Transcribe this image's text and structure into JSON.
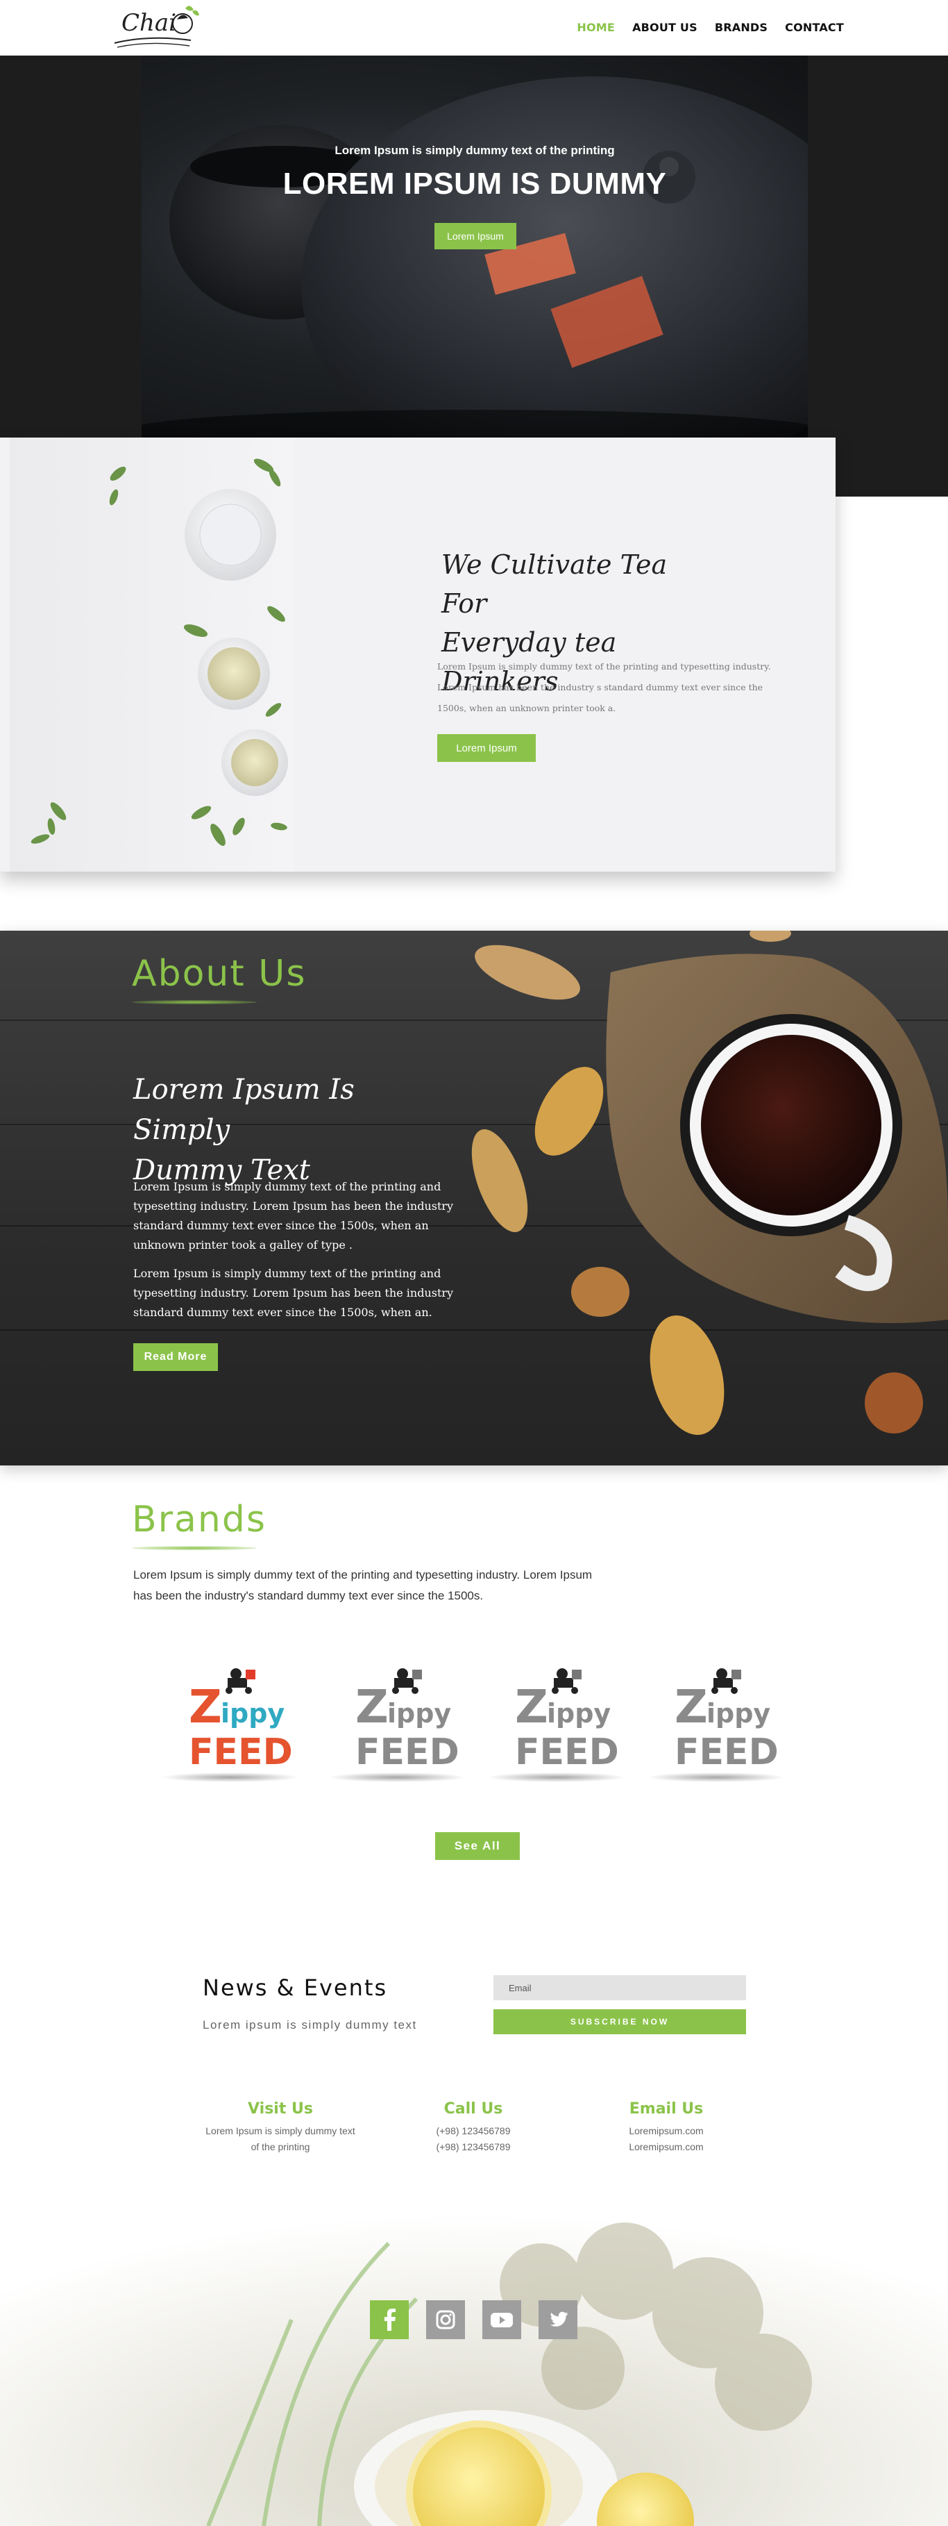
{
  "header": {
    "logo_text": "Chai",
    "nav": [
      {
        "label": "HOME",
        "active": true
      },
      {
        "label": "ABOUT US",
        "active": false
      },
      {
        "label": "BRANDS",
        "active": false
      },
      {
        "label": "CONTACT",
        "active": false
      }
    ]
  },
  "hero": {
    "overline": "Lorem Ipsum is simply dummy text of the printing",
    "title": "LOREM IPSUM IS DUMMY",
    "button_label": "Lorem Ipsum"
  },
  "cultivate": {
    "title_line1": "We Cultivate Tea For",
    "title_line2": "Everyday tea Drinkers",
    "text": "Lorem Ipsum is simply dummy text of the printing and typesetting industry. Lorem Ipsum has been the industry    s standard dummy text ever since the 1500s, when an unknown printer took a.",
    "button_label": "Lorem Ipsum"
  },
  "about": {
    "title": "About Us",
    "heading_line1": "Lorem Ipsum Is Simply",
    "heading_line2": "Dummy Text",
    "paragraph1": "Lorem Ipsum is simply dummy text of the printing and typesetting industry. Lorem Ipsum has been the industry standard dummy text ever since the 1500s, when an unknown printer took a galley of type .",
    "paragraph2": "Lorem Ipsum is simply dummy text of the printing and typesetting industry. Lorem Ipsum has been the industry standard dummy text ever since the 1500s, when an.",
    "button_label": "Read More"
  },
  "brands": {
    "title": "Brands",
    "description": "Lorem Ipsum is simply dummy text of the printing and typesetting industry. Lorem Ipsum has been the industry's standard dummy text ever since the 1500s.",
    "items": [
      {
        "line1_initial": "Z",
        "line1_rest": "ippy",
        "line2": "FEED",
        "colored": true
      },
      {
        "line1_initial": "Z",
        "line1_rest": "ippy",
        "line2": "FEED",
        "colored": false
      },
      {
        "line1_initial": "Z",
        "line1_rest": "ippy",
        "line2": "FEED",
        "colored": false
      },
      {
        "line1_initial": "Z",
        "line1_rest": "ippy",
        "line2": "FEED",
        "colored": false
      }
    ],
    "see_all_label": "See All"
  },
  "news": {
    "title": "News & Events",
    "subtitle": "Lorem ipsum is simply dummy text",
    "email_placeholder": "Email",
    "subscribe_label": "SUBSCRIBE NOW"
  },
  "contact": {
    "visit": {
      "title": "Visit Us",
      "line1": "Lorem Ipsum is simply dummy text",
      "line2": "of the printing"
    },
    "call": {
      "title": "Call Us",
      "line1": "(+98) 123456789",
      "line2": "(+98) 123456789"
    },
    "email": {
      "title": "Email Us",
      "line1": "Loremipsum.com",
      "line2": "Loremipsum.com"
    }
  },
  "social": [
    "facebook-icon",
    "instagram-icon",
    "youtube-icon",
    "twitter-icon"
  ],
  "colors": {
    "accent": "#8bc34a",
    "dark": "#1d1d1d",
    "panel": "#f2f2f4",
    "social_active": "#8bc34a",
    "social_inactive": "#9e9e9e"
  }
}
